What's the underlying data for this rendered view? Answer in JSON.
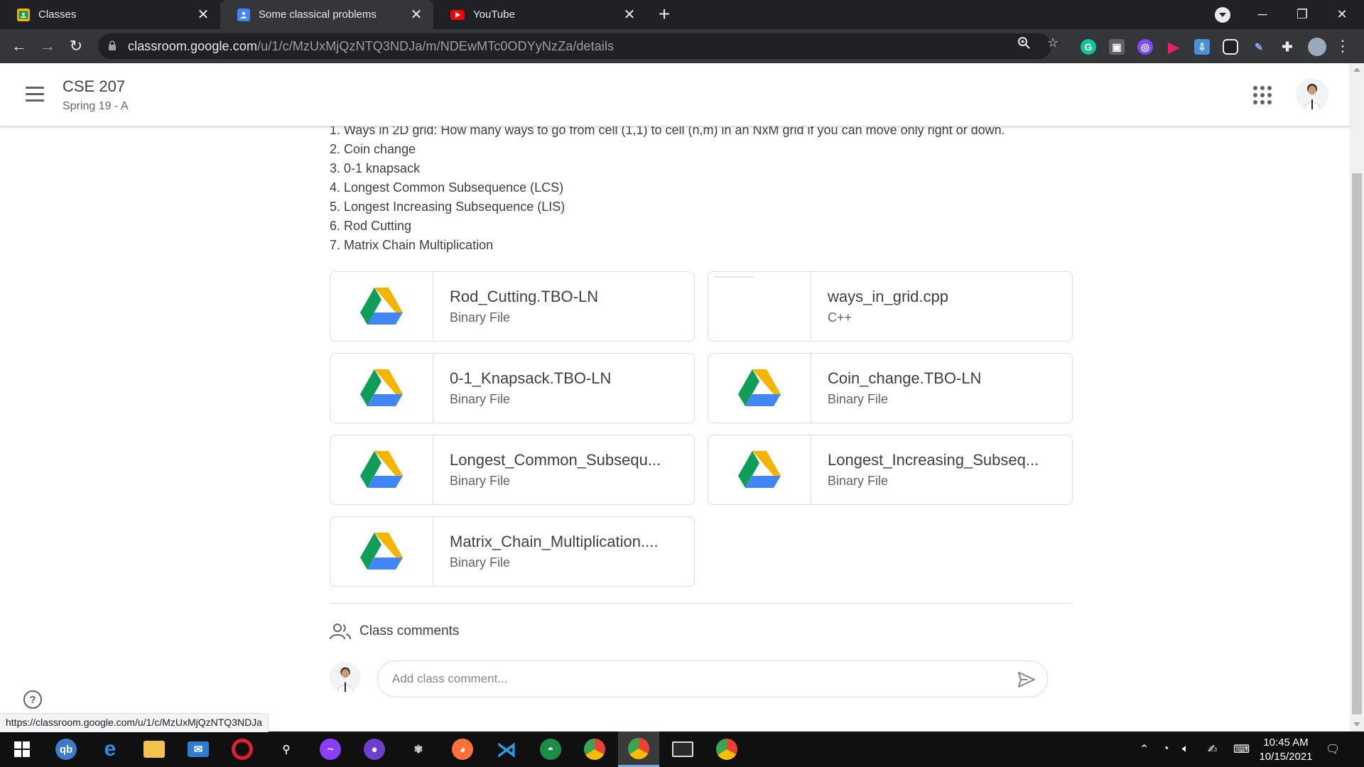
{
  "browser": {
    "tabs": [
      {
        "title": "Classes",
        "active": false
      },
      {
        "title": "Some classical problems",
        "active": true
      },
      {
        "title": "YouTube",
        "active": false
      }
    ],
    "url_host": "classroom.google.com",
    "url_path": "/u/1/c/MzUxMjQzNTQ3NDJa/m/NDEwMTc0ODYyNzZa/details",
    "status_url": "https://classroom.google.com/u/1/c/MzUxMjQzNTQ3NDJa"
  },
  "header": {
    "course_title": "CSE 207",
    "course_section": "Spring 19 - A"
  },
  "problems": [
    "1. Ways in 2D grid: How many ways to go from cell (1,1) to cell (n,m) in an NxM grid if you can move only right or down.",
    "2. Coin change",
    "3. 0-1 knapsack",
    "4. Longest Common Subsequence (LCS)",
    "5. Longest Increasing Subsequence (LIS)",
    "6. Rod Cutting",
    "7. Matrix Chain Multiplication"
  ],
  "attachments": [
    {
      "name": "Rod_Cutting.TBO-LN",
      "type": "Binary File"
    },
    {
      "name": "ways_in_grid.cpp",
      "type": "C++"
    },
    {
      "name": "0-1_Knapsack.TBO-LN",
      "type": "Binary File"
    },
    {
      "name": "Coin_change.TBO-LN",
      "type": "Binary File"
    },
    {
      "name": "Longest_Common_Subsequ...",
      "type": "Binary File"
    },
    {
      "name": "Longest_Increasing_Subseq...",
      "type": "Binary File"
    },
    {
      "name": "Matrix_Chain_Multiplication....",
      "type": "Binary File"
    }
  ],
  "comments": {
    "header": "Class comments",
    "placeholder": "Add class comment..."
  },
  "taskbar": {
    "time": "10:45 AM",
    "date": "10/15/2021"
  },
  "colors": {
    "chrome_dark": "#202124",
    "chrome_toolbar": "#35363a",
    "drive_green": "#0f9d58",
    "drive_yellow": "#f4b400",
    "drive_blue": "#4285f4",
    "text": "#3c4043"
  }
}
